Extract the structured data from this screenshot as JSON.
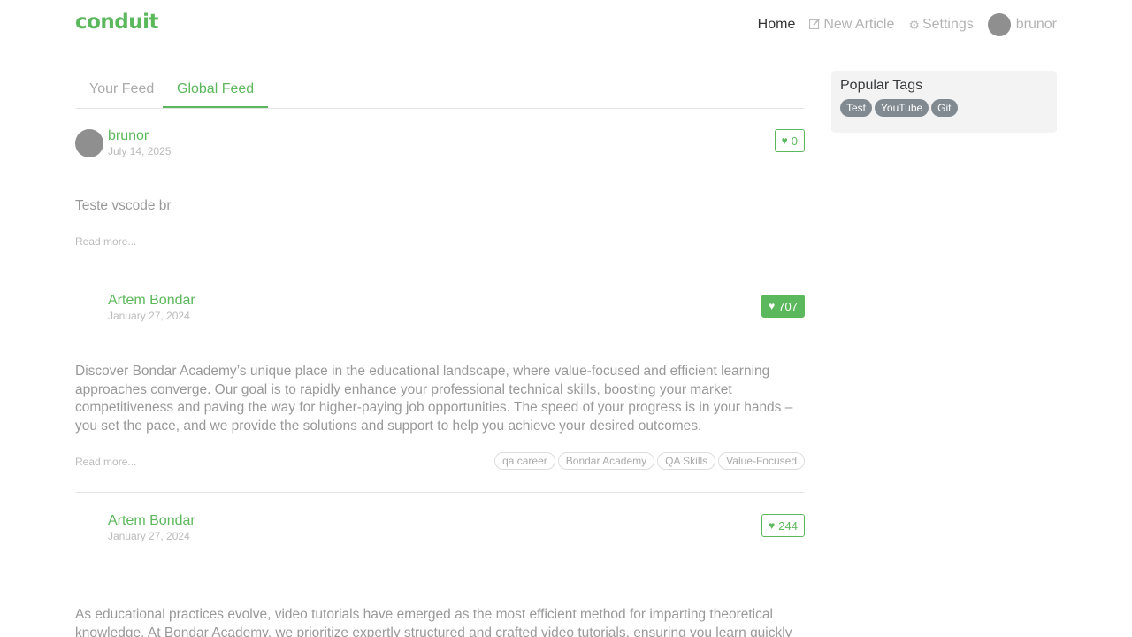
{
  "navbar": {
    "brand": "conduit",
    "links": {
      "home": "Home",
      "new_article": "New Article",
      "settings": "Settings",
      "profile": "brunor"
    },
    "icons": {
      "new_article": "compose-icon",
      "settings": "gear-icon"
    }
  },
  "feed_tabs": {
    "your_feed": "Your Feed",
    "global_feed": "Global Feed"
  },
  "articles": [
    {
      "author": "brunor",
      "date": "July 14, 2025",
      "likes": "0",
      "body": "Teste vscode br",
      "read_more": "Read more...",
      "tags": []
    },
    {
      "author": "Artem Bondar",
      "date": "January 27, 2024",
      "likes": "707",
      "body": "Discover Bondar Academy’s unique place in the educational landscape, where value-focused and efficient learning approaches converge. Our goal is to rapidly enhance your professional technical skills, boosting your market competitiveness and paving the way for higher-paying job opportunities. The speed of your progress is in your hands – you set the pace, and we provide the solutions and support to help you achieve your desired outcomes.",
      "read_more": "Read more...",
      "tags": [
        "qa career",
        "Bondar Academy",
        "QA Skills",
        "Value-Focused"
      ]
    },
    {
      "author": "Artem Bondar",
      "date": "January 27, 2024",
      "likes": "244",
      "body": "As educational practices evolve, video tutorials have emerged as the most efficient method for imparting theoretical knowledge. At Bondar Academy, we prioritize expertly structured and crafted video tutorials, ensuring you learn quickly and"
    }
  ],
  "sidebar": {
    "title": "Popular Tags",
    "tags": [
      "Test",
      "YouTube",
      "Git"
    ]
  },
  "colors": {
    "accent": "#5cb85c",
    "tag_default": "#818a91"
  }
}
